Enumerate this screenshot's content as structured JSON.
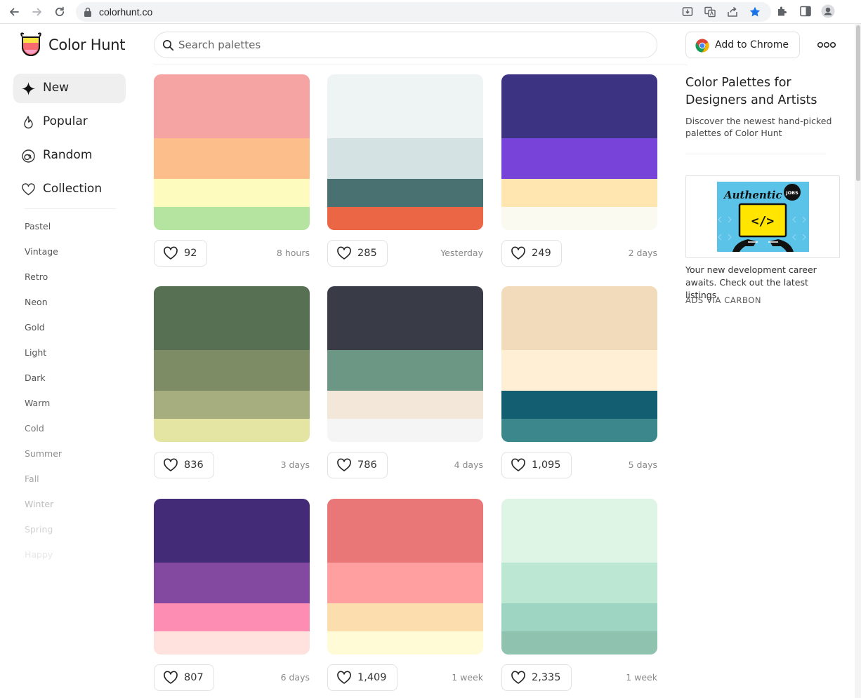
{
  "browser": {
    "url": "colorhunt.co"
  },
  "header": {
    "brand": "Color Hunt",
    "search_placeholder": "Search palettes",
    "chrome_button": "Add to Chrome"
  },
  "sidebar": {
    "items": [
      {
        "label": "New",
        "icon": "sparkle-icon",
        "active": true
      },
      {
        "label": "Popular",
        "icon": "flame-icon"
      },
      {
        "label": "Random",
        "icon": "spiral-icon"
      },
      {
        "label": "Collection",
        "icon": "heart-icon"
      }
    ],
    "tags": [
      "Pastel",
      "Vintage",
      "Retro",
      "Neon",
      "Gold",
      "Light",
      "Dark",
      "Warm",
      "Cold",
      "Summer",
      "Fall",
      "Winter",
      "Spring",
      "Happy"
    ],
    "tag_colors": [
      "#555555",
      "#555555",
      "#555555",
      "#555555",
      "#555555",
      "#555555",
      "#555555",
      "#5e5e5e",
      "#777777",
      "#8d8d8d",
      "#a8a8a8",
      "#bdbdbd",
      "#d3d3d3",
      "#e7e7e7"
    ]
  },
  "palettes": [
    {
      "colors": [
        "#F5A3A3",
        "#FCBF8B",
        "#FEFBBE",
        "#B5E3A0"
      ],
      "likes": "92",
      "age": "8 hours"
    },
    {
      "colors": [
        "#EEF3F3",
        "#D5E2E3",
        "#4A7171",
        "#EB6644"
      ],
      "likes": "285",
      "age": "Yesterday"
    },
    {
      "colors": [
        "#3C3383",
        "#7843D9",
        "#FFE5B0",
        "#FAFAF0"
      ],
      "likes": "249",
      "age": "2 days"
    },
    {
      "colors": [
        "#576F53",
        "#7D8C64",
        "#A6AE7F",
        "#E5E5A3"
      ],
      "likes": "836",
      "age": "3 days"
    },
    {
      "colors": [
        "#393C46",
        "#6C9784",
        "#F2E7D8",
        "#F5F5F5"
      ],
      "likes": "786",
      "age": "4 days"
    },
    {
      "colors": [
        "#F1DBBA",
        "#FFEFD5",
        "#135E71",
        "#3C878C"
      ],
      "likes": "1,095",
      "age": "5 days"
    },
    {
      "colors": [
        "#442B78",
        "#8349A0",
        "#FE8DB3",
        "#FFE1DE"
      ],
      "likes": "807",
      "age": "6 days"
    },
    {
      "colors": [
        "#E97777",
        "#FF9F9F",
        "#FCDDAE",
        "#FFFBD6"
      ],
      "likes": "1,409",
      "age": "1 week"
    },
    {
      "colors": [
        "#DEF4E4",
        "#BCE8D3",
        "#9ED4C2",
        "#8FC3AF"
      ],
      "likes": "2,335",
      "age": "1 week"
    }
  ],
  "right": {
    "title": "Color Palettes for Designers and Artists",
    "description": "Discover the newest hand-picked palettes of Color Hunt",
    "ad_brand": "Authentic",
    "ad_badge": "JOBS",
    "ad_code_glyph": "</>",
    "ad_text": "Your new development career awaits. Check out the latest listings.",
    "ad_via": "ADS VIA CARBON"
  }
}
